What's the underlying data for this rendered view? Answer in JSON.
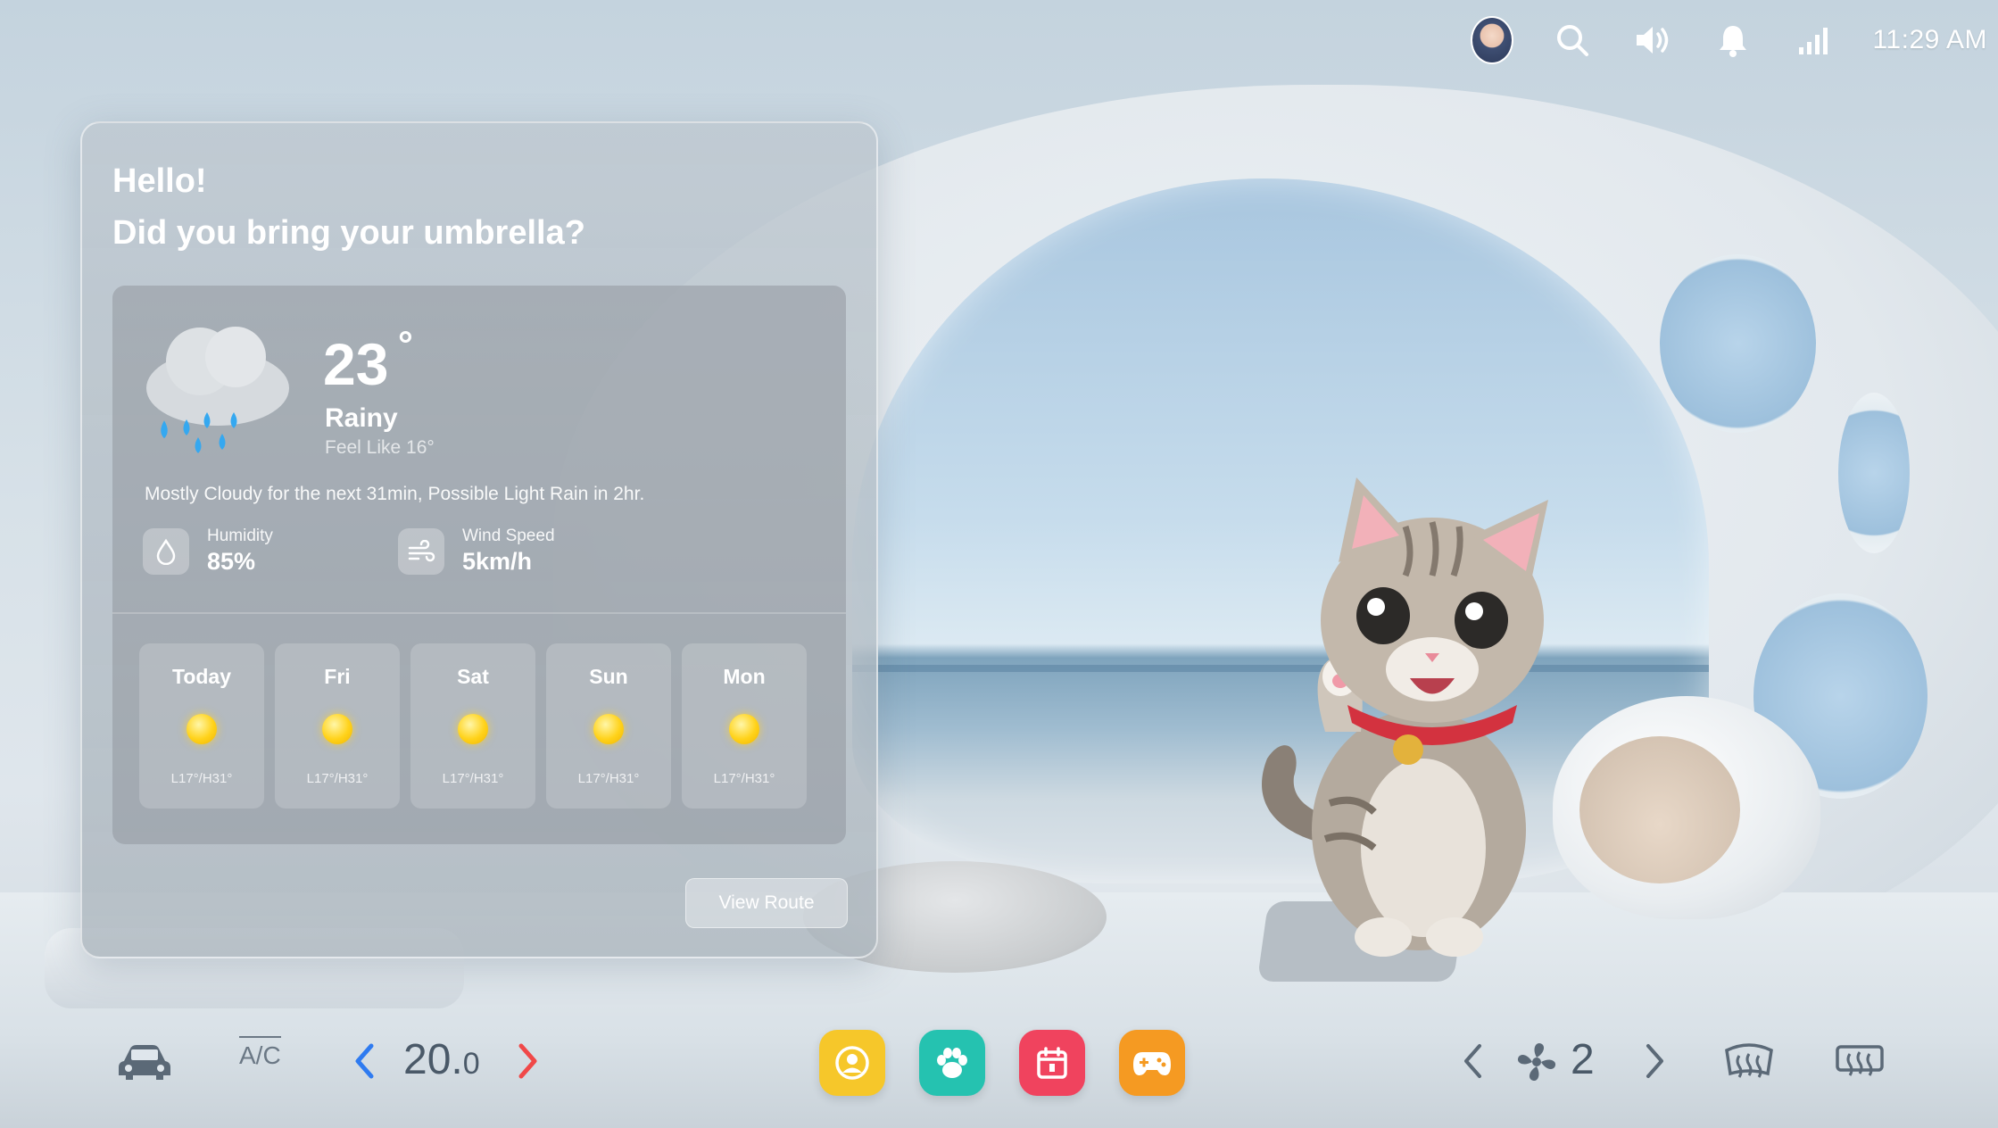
{
  "status_bar": {
    "time": "11:29 AM",
    "icons": [
      "avatar",
      "search-icon",
      "volume-icon",
      "bell-icon",
      "signal-icon"
    ]
  },
  "weather_card": {
    "greeting_line1": "Hello!",
    "greeting_line2": "Did you bring your umbrella?",
    "temperature": "23",
    "degree_symbol": "°",
    "condition": "Rainy",
    "feels_like": "Feel Like 16°",
    "summary": "Mostly Cloudy for the next 31min, Possible Light Rain in 2hr.",
    "humidity": {
      "label": "Humidity",
      "value": "85%"
    },
    "wind": {
      "label": "Wind Speed",
      "value": "5km/h"
    },
    "forecast": [
      {
        "day": "Today",
        "range": "L17°/H31°"
      },
      {
        "day": "Fri",
        "range": "L17°/H31°"
      },
      {
        "day": "Sat",
        "range": "L17°/H31°"
      },
      {
        "day": "Sun",
        "range": "L17°/H31°"
      },
      {
        "day": "Mon",
        "range": "L17°/H31°"
      }
    ],
    "button_label": "View Route"
  },
  "dock": {
    "ac_label": "A/C",
    "temperature_int": "20.",
    "temperature_dec": "0",
    "fan_level": "2",
    "apps": [
      {
        "name": "profile",
        "color": "#F6C72A"
      },
      {
        "name": "pet",
        "color": "#25C2B0"
      },
      {
        "name": "calendar",
        "color": "#F0435E"
      },
      {
        "name": "games",
        "color": "#F59A22"
      }
    ],
    "colors": {
      "arrow_left": "#2F7BF0",
      "arrow_right": "#F04848",
      "icon": "#5B6977"
    }
  }
}
